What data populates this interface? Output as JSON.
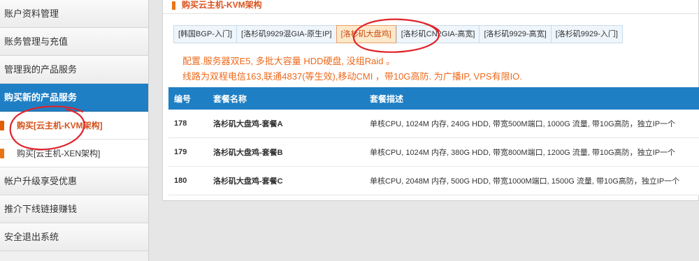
{
  "sidebar": {
    "items": [
      {
        "label": "账户资料管理"
      },
      {
        "label": "账务管理与充值"
      },
      {
        "label": "管理我的产品服务"
      },
      {
        "label": "购买新的产品服务"
      }
    ],
    "sub_items": [
      {
        "label": "购买[云主机-KVM架构]"
      },
      {
        "label": "购买[云主机-XEN架构]"
      }
    ],
    "items_after": [
      {
        "label": "帐户升级享受优惠"
      },
      {
        "label": "推介下线链接赚钱"
      },
      {
        "label": "安全退出系统"
      }
    ]
  },
  "main": {
    "title": "购买云主机-KVM架构",
    "tabs": [
      {
        "label": "[韩国BGP-入门]"
      },
      {
        "label": "[洛杉矶9929混GIA-原生IP]"
      },
      {
        "label": "[洛杉矶大盘鸡]"
      },
      {
        "label": "[洛杉矶CN2GIA-高宽]"
      },
      {
        "label": "[洛杉矶9929-高宽]"
      },
      {
        "label": "[洛杉矶9929-入门]"
      }
    ],
    "notes": [
      "配置.服务器双E5, 多批大容量 HDD硬盘, 没组Raid 。",
      "线路为双程电信163,联通4837(等生效),移动CMI ，带10G高防. 为广播IP, VPS有限IO."
    ],
    "table": {
      "headers": [
        "编号",
        "套餐名称",
        "套餐描述"
      ],
      "rows": [
        {
          "id": "178",
          "name": "洛杉矶大盘鸡-套餐A",
          "desc": "单核CPU, 1024M 内存, 240G HDD, 带宽500M端口, 1000G 流量, 带10G高防，独立IP一个"
        },
        {
          "id": "179",
          "name": "洛杉矶大盘鸡-套餐B",
          "desc": "单核CPU, 1024M 内存, 380G HDD, 带宽800M端口, 1200G 流量, 带10G高防，独立IP一个"
        },
        {
          "id": "180",
          "name": "洛杉矶大盘鸡-套餐C",
          "desc": "单核CPU, 2048M 内存, 500G HDD, 带宽1000M端口, 1500G 流量, 带10G高防，独立IP一个"
        }
      ]
    }
  },
  "colors": {
    "accent_blue": "#1f7fc4",
    "accent_orange": "#e87515",
    "annotation_red": "#e0232b"
  }
}
